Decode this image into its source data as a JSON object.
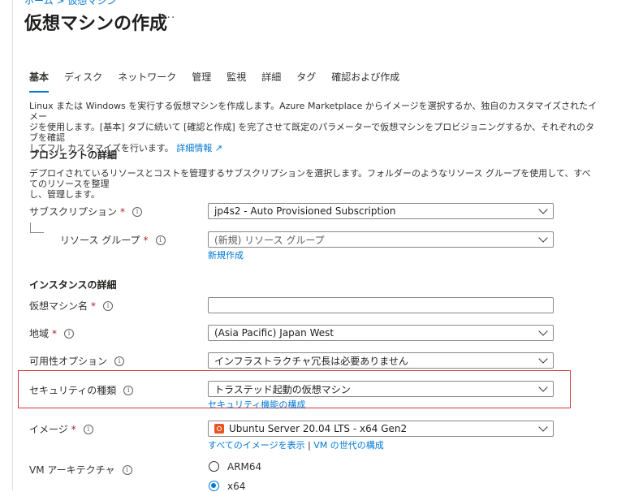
{
  "breadcrumb_cut": "ホーム > 仮想マシン",
  "page_title": "仮想マシンの作成",
  "more_label": "···",
  "tabs": [
    {
      "label": "基本"
    },
    {
      "label": "ディスク"
    },
    {
      "label": "ネットワーク"
    },
    {
      "label": "管理"
    },
    {
      "label": "監視"
    },
    {
      "label": "詳細"
    },
    {
      "label": "タグ"
    },
    {
      "label": "確認および作成"
    }
  ],
  "intro": {
    "line1": "Linux または Windows を実行する仮想マシンを作成します。Azure Marketplace からイメージを選択するか、独自のカスタマイズされたイメー",
    "line2": "ジを使用します。[基本] タブに続いて [確認と作成] を完了させて既定のパラメーターで仮想マシンをプロビジョニングするか、それぞれのタブを確認",
    "line3": "してフル カスタマイズを行います。",
    "link": "詳細情報"
  },
  "project": {
    "heading": "プロジェクトの詳細",
    "desc1": "デプロイされているリソースとコストを管理するサブスクリプションを選択します。フォルダーのようなリソース グループを使用して、すべてのリソースを整理",
    "desc2": "し、管理します。",
    "subscription_label": "サブスクリプション",
    "subscription_value": "jp4s2 - Auto Provisioned Subscription",
    "rg_label": "リソース グループ",
    "rg_placeholder": "(新規) リソース グループ",
    "rg_new_link": "新規作成"
  },
  "instance": {
    "heading": "インスタンスの詳細",
    "vmname_label": "仮想マシン名",
    "vmname_value": "",
    "region_label": "地域",
    "region_value": "(Asia Pacific) Japan West",
    "avail_label": "可用性オプション",
    "avail_value": "インフラストラクチャ冗長は必要ありません",
    "security_label": "セキュリティの種類",
    "security_value": "トラステッド起動の仮想マシン",
    "security_link": "セキュリティ機能の構成",
    "image_label": "イメージ",
    "image_value": "Ubuntu Server 20.04 LTS - x64 Gen2",
    "image_link1": "すべてのイメージを表示",
    "image_sep": "|",
    "image_link2": "VM の世代の構成",
    "arch_label": "VM アーキテクチャ",
    "arch_opt1": "ARM64",
    "arch_opt2": "x64"
  },
  "required_mark": "*",
  "info_glyph": "i",
  "colors": {
    "accent": "#0078d4",
    "required": "#a4262c",
    "highlight": "#d13438"
  }
}
